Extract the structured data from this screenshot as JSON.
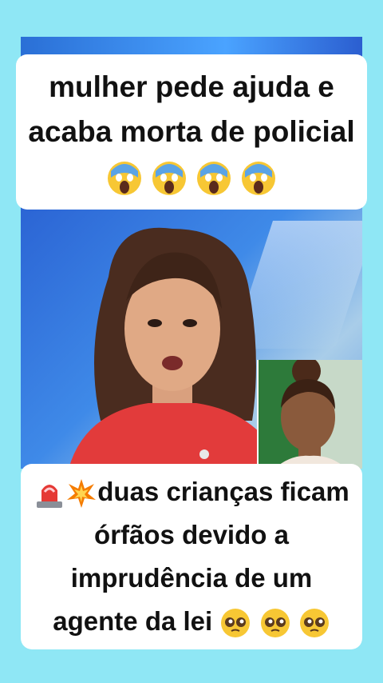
{
  "post": {
    "title_text": "mulher pede ajuda e acaba morta de policial",
    "title_emoji": [
      "scream-face",
      "scream-face",
      "scream-face",
      "scream-face"
    ],
    "bottom_prefix_icons": [
      "police-light",
      "collision"
    ],
    "bottom_text": "duas crianças ficam órfãos devido a imprudência de um agente da lei",
    "bottom_suffix_emoji": [
      "pleading-face",
      "pleading-face",
      "pleading-face"
    ]
  },
  "colors": {
    "background": "#8fe7f5",
    "caption_bg": "#ffffff",
    "caption_text": "#111111",
    "video_blue": "#2b64d4",
    "anchor_shirt": "#e23b3b"
  }
}
